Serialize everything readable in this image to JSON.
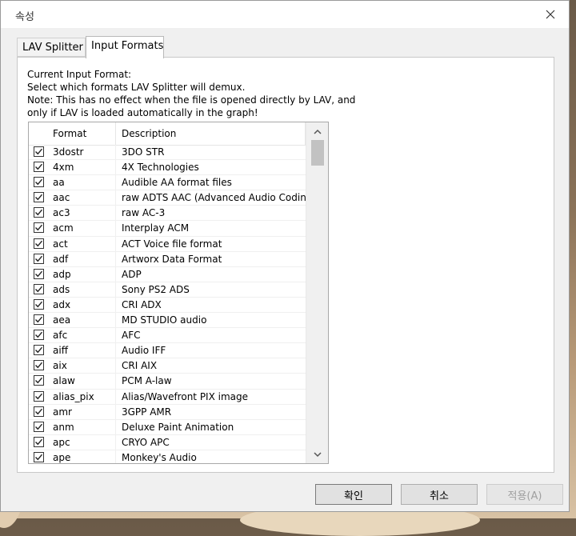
{
  "window": {
    "title": "속성",
    "close_glyph": "✕"
  },
  "tabs": [
    {
      "label": "LAV Splitter",
      "active": false
    },
    {
      "label": "Input Formats",
      "active": true
    }
  ],
  "panel": {
    "heading": "Current Input Format:",
    "lines": [
      "Select which formats LAV Splitter will demux.",
      "Note: This has no effect when the file is opened directly by LAV, and",
      "only if LAV is loaded automatically in the graph!"
    ]
  },
  "list": {
    "columns": {
      "format": "Format",
      "description": "Description"
    },
    "rows": [
      {
        "format": "3dostr",
        "description": "3DO STR",
        "checked": true
      },
      {
        "format": "4xm",
        "description": "4X Technologies",
        "checked": true
      },
      {
        "format": "aa",
        "description": "Audible AA format files",
        "checked": true
      },
      {
        "format": "aac",
        "description": "raw ADTS AAC (Advanced Audio Coding)",
        "checked": true
      },
      {
        "format": "ac3",
        "description": "raw AC-3",
        "checked": true
      },
      {
        "format": "acm",
        "description": "Interplay ACM",
        "checked": true
      },
      {
        "format": "act",
        "description": "ACT Voice file format",
        "checked": true
      },
      {
        "format": "adf",
        "description": "Artworx Data Format",
        "checked": true
      },
      {
        "format": "adp",
        "description": "ADP",
        "checked": true
      },
      {
        "format": "ads",
        "description": "Sony PS2 ADS",
        "checked": true
      },
      {
        "format": "adx",
        "description": "CRI ADX",
        "checked": true
      },
      {
        "format": "aea",
        "description": "MD STUDIO audio",
        "checked": true
      },
      {
        "format": "afc",
        "description": "AFC",
        "checked": true
      },
      {
        "format": "aiff",
        "description": "Audio IFF",
        "checked": true
      },
      {
        "format": "aix",
        "description": "CRI AIX",
        "checked": true
      },
      {
        "format": "alaw",
        "description": "PCM A-law",
        "checked": true
      },
      {
        "format": "alias_pix",
        "description": "Alias/Wavefront PIX image",
        "checked": true
      },
      {
        "format": "amr",
        "description": "3GPP AMR",
        "checked": true
      },
      {
        "format": "anm",
        "description": "Deluxe Paint Animation",
        "checked": true
      },
      {
        "format": "apc",
        "description": "CRYO APC",
        "checked": true
      },
      {
        "format": "ape",
        "description": "Monkey's Audio",
        "checked": true
      }
    ]
  },
  "buttons": {
    "ok": "확인",
    "cancel": "취소",
    "apply": "적용(A)",
    "apply_enabled": false
  },
  "icons": {
    "checkbox": "checkmark-icon",
    "scroll_up": "chevron-up-icon",
    "scroll_down": "chevron-down-icon",
    "close": "close-icon"
  }
}
